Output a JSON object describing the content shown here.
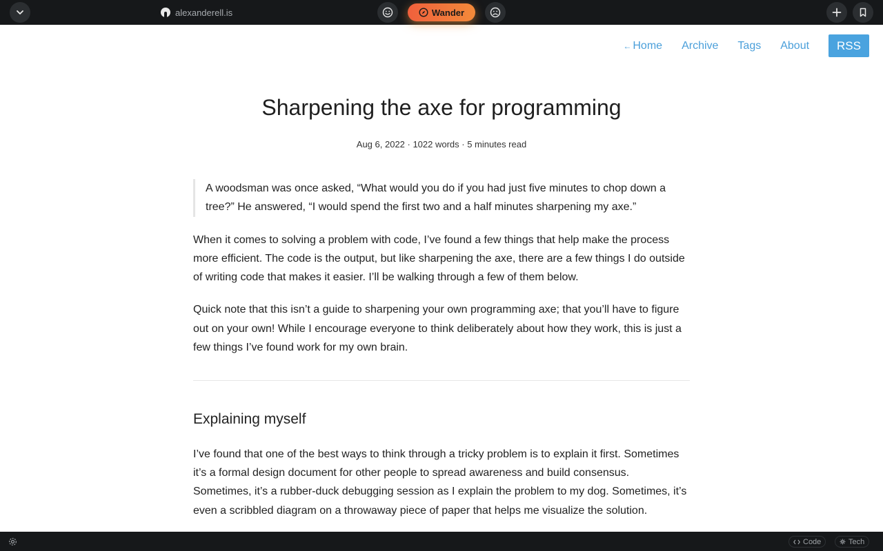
{
  "browser": {
    "url": "alexanderell.is",
    "wander_label": "Wander",
    "bottom_tags": [
      "Code",
      "Tech"
    ]
  },
  "nav": {
    "home_arrow": "←",
    "home": "Home",
    "archive": "Archive",
    "tags": "Tags",
    "about": "About",
    "rss": "RSS"
  },
  "article": {
    "title": "Sharpening the axe for programming",
    "meta": "Aug 6, 2022 · 1022 words · 5 minutes read",
    "quote": "A woodsman was once asked, “What would you do if you had just five minutes to chop down a tree?” He answered, “I would spend the first two and a half minutes sharpening my axe.”",
    "paragraphs": [
      "When it comes to solving a problem with code, I’ve found a few things that help make the process more efficient. The code is the output, but like sharpening the axe, there are a few things I do outside of writing code that makes it easier. I’ll be walking through a few of them below.",
      "Quick note that this isn’t a guide to sharpening your own programming axe; that you’ll have to figure out on your own! While I encourage everyone to think deliberately about how they work, this is just a few things I’ve found work for my own brain."
    ],
    "section_heading": "Explaining myself",
    "section_paragraph": "I’ve found that one of the best ways to think through a tricky problem is to explain it first. Sometimes it’s a formal design document for other people to spread awareness and build consensus. Sometimes, it’s a rubber-duck debugging session as I explain the problem to my dog. Sometimes, it’s even a scribbled diagram on a throwaway piece of paper that helps me visualize the solution."
  },
  "colors": {
    "link": "#4a9fda",
    "rss_bg": "#4aa3df",
    "wander_gradient": [
      "#f0603c",
      "#f38a3a"
    ],
    "chrome_bg": "#16181a"
  }
}
